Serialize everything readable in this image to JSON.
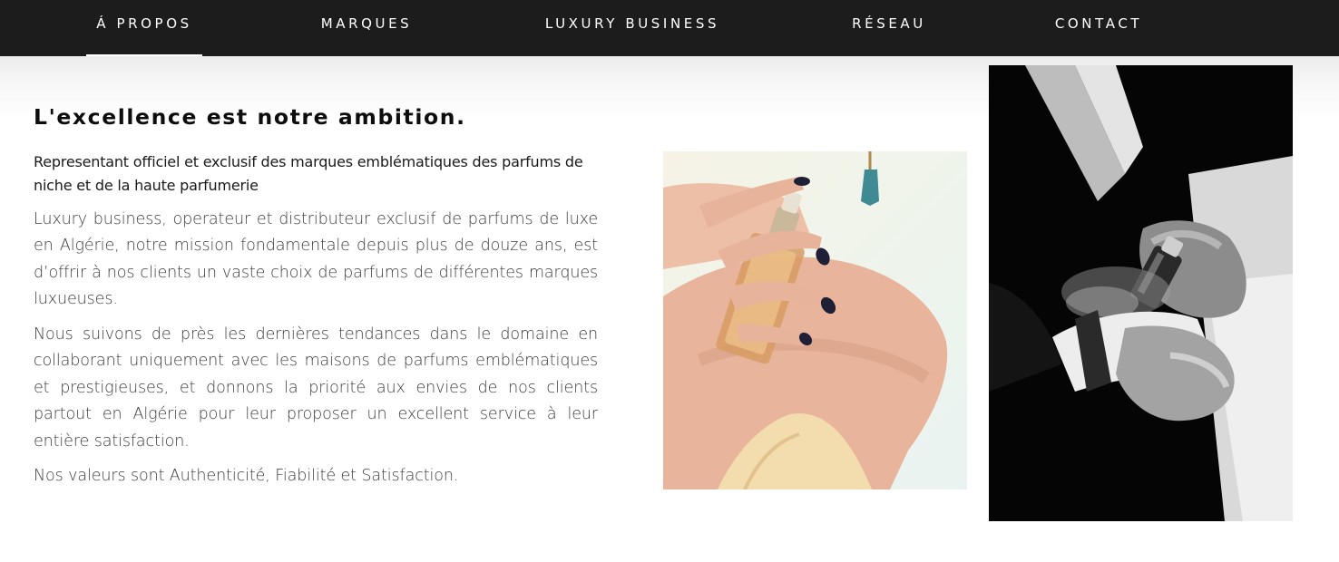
{
  "nav": {
    "items": [
      {
        "label": "Á PROPOS",
        "active": true
      },
      {
        "label": "MARQUES",
        "active": false
      },
      {
        "label": "LUXURY BUSINESS",
        "active": false
      },
      {
        "label": "RÉSEAU",
        "active": false
      },
      {
        "label": "CONTACT",
        "active": false
      }
    ]
  },
  "content": {
    "headline": "L'excellence est notre ambition.",
    "subheading": "Representant officiel et exclusif des marques emblématiques des parfums de niche et de la haute parfumerie",
    "paragraphs": [
      "Luxury business, operateur et distributeur exclusif de parfums de luxe en Algérie, notre mission fondamentale depuis plus de douze ans, est d’offrir à nos clients un vaste choix de parfums de différentes marques luxueuses.",
      "Nous suivons de près les dernières tendances dans le domaine en collaborant uniquement avec les maisons de parfums emblématiques et prestigieuses, et donnons la priorité aux envies de nos clients partout en Algérie pour leur proposer un excellent service à leur entière satisfaction.",
      "Nos valeurs sont Authenticité, Fiabilité et Satisfaction."
    ]
  },
  "colors": {
    "nav_background": "#1c1c1c",
    "nav_text": "#ffffff",
    "heading": "#0d0d0d",
    "body_text": "#3d3d3d"
  }
}
